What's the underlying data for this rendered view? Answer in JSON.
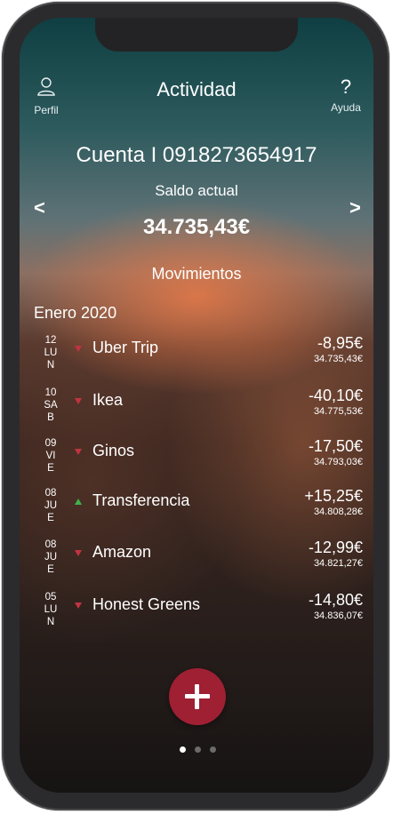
{
  "header": {
    "title": "Actividad",
    "profile_label": "Perfil",
    "help_label": "Ayuda",
    "help_glyph": "?"
  },
  "account": {
    "label": "Cuenta I 0918273654917",
    "saldo_label": "Saldo actual",
    "balance": "34.735,43€",
    "prev_glyph": "<",
    "next_glyph": ">"
  },
  "movements": {
    "title": "Movimientos",
    "month": "Enero 2020",
    "items": [
      {
        "day": "12",
        "wd1": "LU",
        "wd2": "N",
        "name": "Uber Trip",
        "amount": "-8,95€",
        "balance": "34.735,43€",
        "direction": "down"
      },
      {
        "day": "10",
        "wd1": "SA",
        "wd2": "B",
        "name": "Ikea",
        "amount": "-40,10€",
        "balance": "34.775,53€",
        "direction": "down"
      },
      {
        "day": "09",
        "wd1": "VI",
        "wd2": "E",
        "name": "Ginos",
        "amount": "-17,50€",
        "balance": "34.793,03€",
        "direction": "down"
      },
      {
        "day": "08",
        "wd1": "JU",
        "wd2": "E",
        "name": "Transferencia",
        "amount": "+15,25€",
        "balance": "34.808,28€",
        "direction": "up"
      },
      {
        "day": "08",
        "wd1": "JU",
        "wd2": "E",
        "name": "Amazon",
        "amount": "-12,99€",
        "balance": "34.821,27€",
        "direction": "down"
      },
      {
        "day": "05",
        "wd1": "LU",
        "wd2": "N",
        "name": "Honest Greens",
        "amount": "-14,80€",
        "balance": "34.836,07€",
        "direction": "down"
      }
    ]
  },
  "pager": {
    "pages": 3,
    "active": 0
  },
  "colors": {
    "accent": "#9f1f33",
    "down": "#c23342",
    "up": "#3fb34a"
  },
  "icons": {
    "profile": "user-icon",
    "add": "plus-icon"
  }
}
